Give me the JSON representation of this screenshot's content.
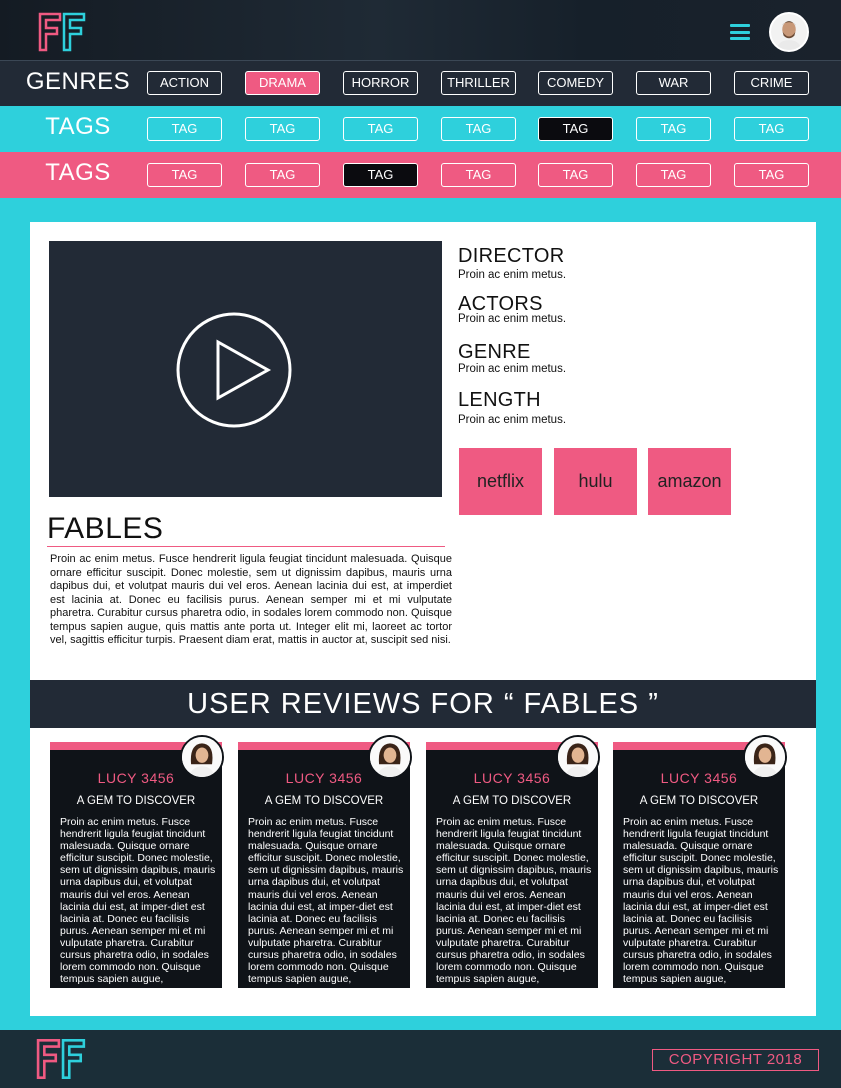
{
  "header": {
    "logo_text": "FF",
    "menu_icon": "hamburger-icon",
    "avatar_icon": "user-avatar"
  },
  "filters": {
    "genres": {
      "label": "GENRES",
      "items": [
        "ACTION",
        "DRAMA",
        "HORROR",
        "THRILLER",
        "COMEDY",
        "WAR",
        "CRIME"
      ],
      "active_index": 1
    },
    "tags_primary": {
      "label": "TAGS",
      "items": [
        "TAG",
        "TAG",
        "TAG",
        "TAG",
        "TAG",
        "TAG",
        "TAG"
      ],
      "active_index": 4
    },
    "tags_secondary": {
      "label": "TAGS",
      "items": [
        "TAG",
        "TAG",
        "TAG",
        "TAG",
        "TAG",
        "TAG",
        "TAG"
      ],
      "active_index": 2
    }
  },
  "movie": {
    "title": "FABLES",
    "synopsis": "Proin ac enim metus. Fusce hendrerit ligula feugiat tincidunt malesuada. Quisque ornare efficitur suscipit. Donec molestie, sem ut dignissim dapibus, mauris urna dapibus dui, et volutpat mauris dui vel eros. Aenean lacinia dui est, at imperdiet est lacinia at. Donec eu facilisis purus. Aenean semper mi et mi vulputate pharetra. Curabitur cursus pharetra odio, in sodales lorem commodo non. Quisque tempus sapien augue, quis mattis ante porta ut. Integer elit mi, laoreet ac tortor vel, sagittis efficitur turpis. Praesent diam erat, mattis in auctor at, suscipit sed nisi.",
    "meta": [
      {
        "heading": "DIRECTOR",
        "value": "Proin ac enim metus."
      },
      {
        "heading": "ACTORS",
        "value": "Proin ac enim metus."
      },
      {
        "heading": "GENRE",
        "value": "Proin ac enim metus."
      },
      {
        "heading": "LENGTH",
        "value": "Proin ac enim metus."
      }
    ],
    "streaming": [
      "netflix",
      "hulu",
      "amazon"
    ]
  },
  "reviews": {
    "heading": "USER REVIEWS FOR “ FABLES ”",
    "items": [
      {
        "user": "LUCY 3456",
        "headline": "A GEM TO DISCOVER",
        "body": "Proin ac enim metus. Fusce hendrerit ligula feugiat tincidunt malesuada. Quisque ornare efficitur suscipit. Donec molestie, sem ut dignissim dapibus, mauris urna dapibus dui, et volutpat mauris dui vel eros. Aenean lacinia dui est, at imper-diet est lacinia at. Donec eu facilisis purus. Aenean semper mi et mi vulputate pharetra. Curabitur cursus pharetra odio, in sodales lorem commodo non. Quisque tempus sapien augue,"
      },
      {
        "user": "LUCY 3456",
        "headline": "A GEM TO DISCOVER",
        "body": "Proin ac enim metus. Fusce hendrerit ligula feugiat tincidunt malesuada. Quisque ornare efficitur suscipit. Donec molestie, sem ut dignissim dapibus, mauris urna dapibus dui, et volutpat mauris dui vel eros. Aenean lacinia dui est, at imper-diet est lacinia at. Donec eu facilisis purus. Aenean semper mi et mi vulputate pharetra. Curabitur cursus pharetra odio, in sodales lorem commodo non. Quisque tempus sapien augue,"
      },
      {
        "user": "LUCY 3456",
        "headline": "A GEM TO DISCOVER",
        "body": "Proin ac enim metus. Fusce hendrerit ligula feugiat tincidunt malesuada. Quisque ornare efficitur suscipit. Donec molestie, sem ut dignissim dapibus, mauris urna dapibus dui, et volutpat mauris dui vel eros. Aenean lacinia dui est, at imper-diet est lacinia at. Donec eu facilisis purus. Aenean semper mi et mi vulputate pharetra. Curabitur cursus pharetra odio, in sodales lorem commodo non. Quisque tempus sapien augue,"
      },
      {
        "user": "LUCY 3456",
        "headline": "A GEM TO DISCOVER",
        "body": "Proin ac enim metus. Fusce hendrerit ligula feugiat tincidunt malesuada. Quisque ornare efficitur suscipit. Donec molestie, sem ut dignissim dapibus, mauris urna dapibus dui, et volutpat mauris dui vel eros. Aenean lacinia dui est, at imper-diet est lacinia at. Donec eu facilisis purus. Aenean semper mi et mi vulputate pharetra. Curabitur cursus pharetra odio, in sodales lorem commodo non. Quisque tempus sapien augue,"
      }
    ]
  },
  "footer": {
    "logo_text": "FF",
    "copyright": "COPYRIGHT 2018"
  },
  "colors": {
    "accent_pink": "#ef5a82",
    "accent_cyan": "#2ed0dc",
    "dark": "#222a36"
  }
}
